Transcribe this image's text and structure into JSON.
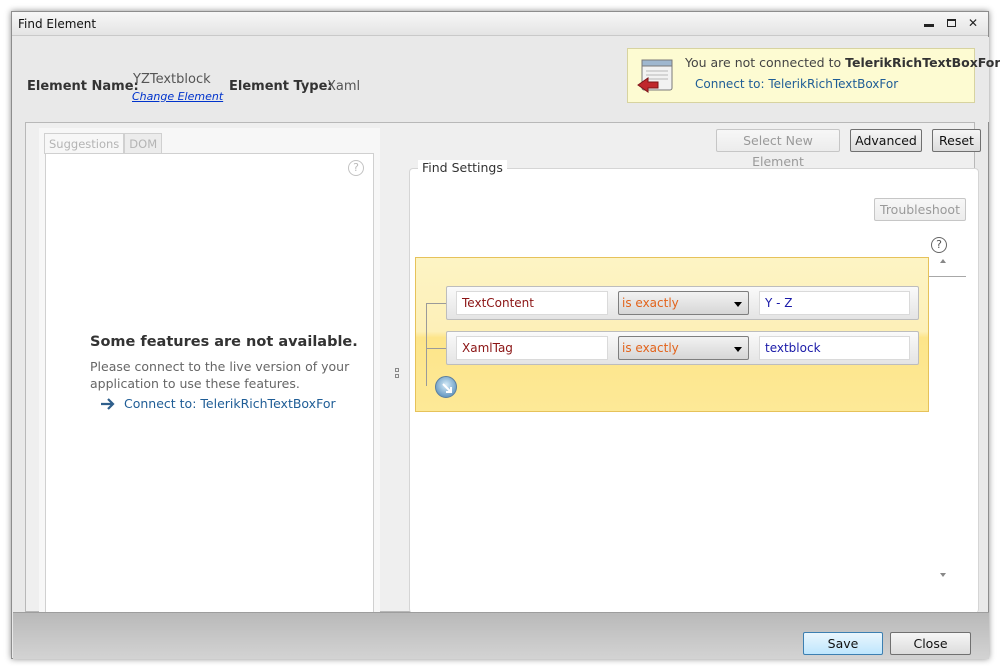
{
  "window": {
    "title": "Find Element"
  },
  "header": {
    "element_name_label": "Element Name:",
    "element_name_value": "YZTextblock",
    "change_element_link": "Change Element",
    "element_type_label": "Element Type:",
    "element_type_value": "Xaml"
  },
  "notice": {
    "text_prefix": "You are not connected to ",
    "app_name": "TelerikRichTextBoxFor",
    "connect_link": "Connect to: TelerikRichTextBoxFor"
  },
  "left_pane": {
    "tabs": [
      "Suggestions",
      "DOM"
    ],
    "unavailable_title": "Some features are not available.",
    "unavailable_text": "Please connect to the live version of your application to use these features.",
    "connect_link": "Connect to: TelerikRichTextBoxFor"
  },
  "toolbar": {
    "select_new_element": "Select New Element",
    "advanced": "Advanced",
    "reset": "Reset"
  },
  "find_settings": {
    "legend": "Find Settings",
    "troubleshoot": "Troubleshoot",
    "rules": [
      {
        "attribute": "TextContent",
        "operator": "is exactly",
        "value": "Y - Z"
      },
      {
        "attribute": "XamlTag",
        "operator": "is exactly",
        "value": "textblock"
      }
    ]
  },
  "footer": {
    "save": "Save",
    "close": "Close"
  },
  "colors": {
    "accent": "#1f5d96",
    "rule_highlight": "#fde58a",
    "operator": "#e2631b"
  }
}
